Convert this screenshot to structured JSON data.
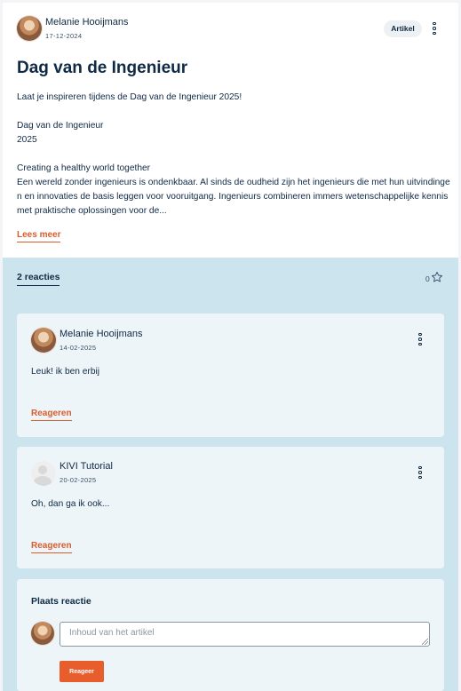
{
  "post": {
    "author": "Melanie Hooijmans",
    "date": "17-12-2024",
    "type_badge": "Artikel",
    "title": "Dag van de Ingenieur",
    "intro": "Laat je inspireren tijdens de Dag van de Ingenieur 2025!",
    "event_name": "Dag van de Ingenieur",
    "event_year": "2025",
    "subheading": "Creating a healthy world together",
    "body": "Een wereld zonder ingenieurs is ondenkbaar. Al sinds de oudheid zijn het ingenieurs die met hun uitvindingen en innovaties de basis leggen voor vooruitgang. Ingenieurs combineren immers wetenschappelijke kennis met praktische oplossingen voor de...",
    "read_more": "Lees meer"
  },
  "reactions": {
    "tab_label": "2 reacties",
    "like_count": "0",
    "items": [
      {
        "author": "Melanie Hooijmans",
        "date": "14-02-2025",
        "text": "Leuk! ik ben erbij",
        "reply_label": "Reageren"
      },
      {
        "author": "KIVI Tutorial",
        "date": "20-02-2025",
        "text": "Oh, dan ga ik ook...",
        "reply_label": "Reageren"
      }
    ]
  },
  "compose": {
    "title": "Plaats reactie",
    "placeholder": "Inhoud van het artikel",
    "submit_label": "Reageer"
  },
  "colors": {
    "accent": "#e85d2c",
    "link": "#d95c2c",
    "text": "#0f2a44",
    "panel": "#cce4ee",
    "card": "#eef5f9"
  }
}
